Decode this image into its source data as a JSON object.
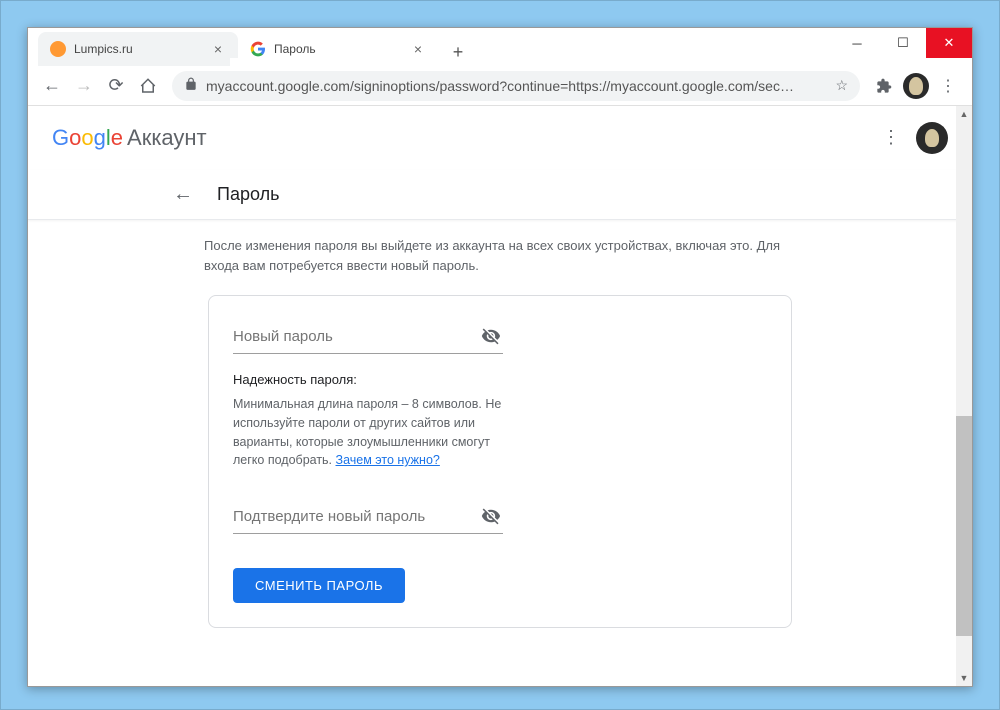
{
  "window": {
    "tabs": [
      {
        "title": "Lumpics.ru",
        "active": false
      },
      {
        "title": "Пароль",
        "active": true
      }
    ],
    "url": "myaccount.google.com/signinoptions/password?continue=https://myaccount.google.com/sec…"
  },
  "header": {
    "brand": "Google",
    "product": "Аккаунт"
  },
  "subheader": {
    "title": "Пароль"
  },
  "page": {
    "description": "После изменения пароля вы выйдете из аккаунта на всех своих устройствах, включая это. Для входа вам потребуется ввести новый пароль.",
    "new_password_placeholder": "Новый пароль",
    "confirm_password_placeholder": "Подтвердите новый пароль",
    "strength_title": "Надежность пароля:",
    "strength_text": "Минимальная длина пароля – 8 символов. Не используйте пароли от других сайтов или варианты, которые злоумышленники смогут легко подобрать.",
    "learn_more": "Зачем это нужно?",
    "submit_label": "СМЕНИТЬ ПАРОЛЬ"
  }
}
